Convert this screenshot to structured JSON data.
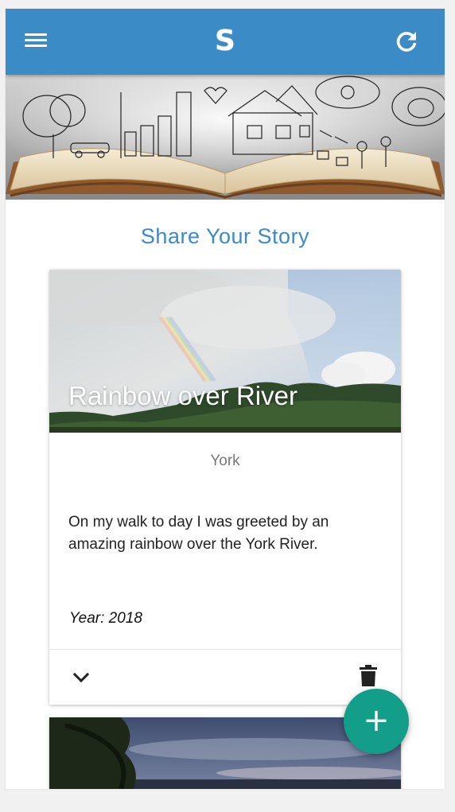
{
  "app": {
    "logo_text": "S",
    "colors": {
      "appbar": "#3b8bc6",
      "title": "#3b8bc6",
      "fab": "#139e8a"
    },
    "icons": {
      "menu": "menu-icon",
      "refresh": "refresh-icon",
      "expand": "chevron-down-icon",
      "delete": "trash-icon",
      "add": "plus-icon"
    }
  },
  "main": {
    "title": "Share Your Story"
  },
  "stories": [
    {
      "title": "Rainbow over River",
      "location": "York",
      "description": "On my walk to day I was greeted by an amazing rainbow over the York River.",
      "year": "Year: 2018"
    }
  ],
  "fab": {
    "label": "+"
  }
}
